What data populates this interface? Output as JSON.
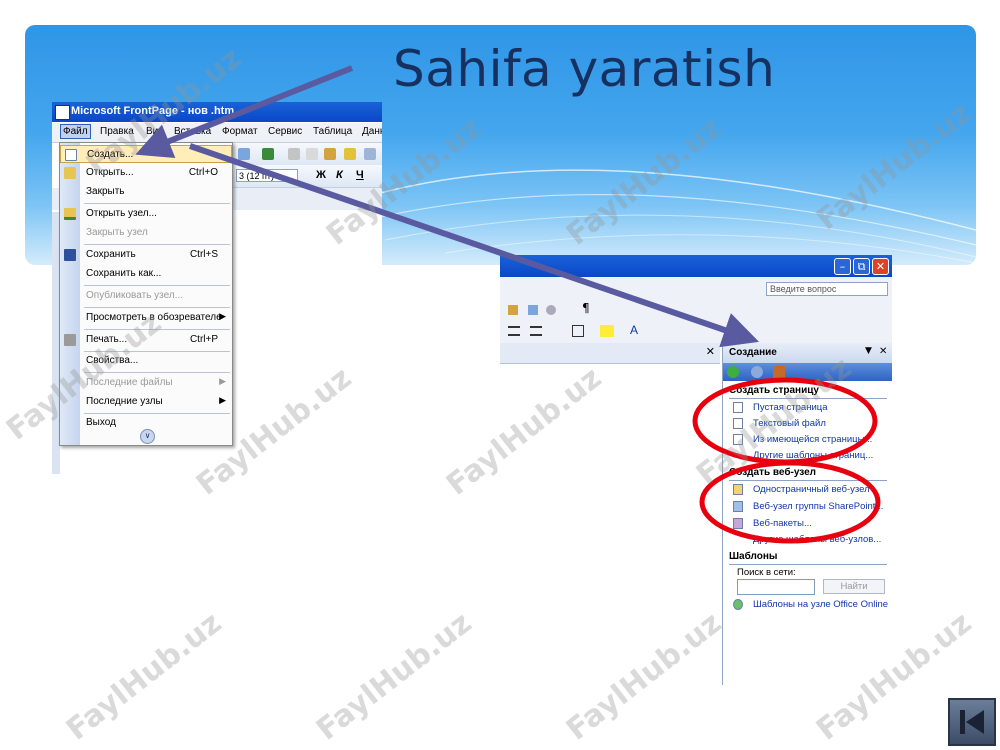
{
  "slide": {
    "title": "Sahifa yaratish"
  },
  "frontpage_window": {
    "title": "Microsoft FrontPage - нов  .htm",
    "menubar": [
      "Файл",
      "Правка",
      "Вид",
      "Вставка",
      "Формат",
      "Сервис",
      "Таблица",
      "Данн"
    ],
    "active_menu": "Файл",
    "file_menu": [
      {
        "label": "Создать...",
        "shortcut": "",
        "submenu": false,
        "disabled": false,
        "highlighted": true,
        "icon": "new-page-icon"
      },
      {
        "label": "Открыть...",
        "shortcut": "Ctrl+O",
        "submenu": false,
        "disabled": false,
        "icon": "open-folder-icon"
      },
      {
        "label": "Закрыть",
        "shortcut": "",
        "submenu": false,
        "disabled": false,
        "icon": ""
      },
      {
        "label": "Открыть узел...",
        "shortcut": "",
        "submenu": false,
        "disabled": false,
        "icon": "open-site-icon"
      },
      {
        "label": "Закрыть узел",
        "shortcut": "",
        "submenu": false,
        "disabled": true,
        "icon": ""
      },
      {
        "label": "Сохранить",
        "shortcut": "Ctrl+S",
        "submenu": false,
        "disabled": false,
        "icon": "save-icon"
      },
      {
        "label": "Сохранить как...",
        "shortcut": "",
        "submenu": false,
        "disabled": false,
        "icon": ""
      },
      {
        "label": "Опубликовать узел...",
        "shortcut": "",
        "submenu": false,
        "disabled": true,
        "icon": ""
      },
      {
        "label": "Просмотреть в обозревателе",
        "shortcut": "",
        "submenu": true,
        "disabled": false,
        "icon": ""
      },
      {
        "label": "Печать...",
        "shortcut": "Ctrl+P",
        "submenu": false,
        "disabled": false,
        "icon": "print-icon"
      },
      {
        "label": "Свойства...",
        "shortcut": "",
        "submenu": false,
        "disabled": false,
        "icon": ""
      },
      {
        "label": "Последние файлы",
        "shortcut": "",
        "submenu": true,
        "disabled": true,
        "icon": ""
      },
      {
        "label": "Последние узлы",
        "shortcut": "",
        "submenu": true,
        "disabled": false,
        "icon": ""
      },
      {
        "label": "Выход",
        "shortcut": "",
        "submenu": false,
        "disabled": false,
        "icon": ""
      }
    ],
    "font_size_value": "3 (12 пт)",
    "bold_label": "Ж",
    "italic_label": "К",
    "underline_label": "Ч"
  },
  "task_window": {
    "ask_question": "Введите вопрос",
    "pane_title": "Создание",
    "sections": [
      {
        "title": "Создать страницу",
        "links": [
          "Пустая страница",
          "Текстовый файл",
          "Из имеющейся страницы...",
          "Другие шаблоны страниц..."
        ]
      },
      {
        "title": "Создать веб-узел",
        "links": [
          "Одностраничный веб-узел",
          "Веб-узел группы SharePoint...",
          "Веб-пакеты...",
          "Другие шаблоны веб-узлов..."
        ]
      },
      {
        "title": "Шаблоны",
        "links": []
      }
    ],
    "search_label": "Поиск в сети:",
    "search_value": "",
    "search_button": "Найти",
    "office_online_link": "Шаблоны на узле Office Online"
  },
  "watermark": "FaylHub.uz",
  "colors": {
    "header_blue": "#2f95e6",
    "title_navy": "#16305f",
    "arrow": "#5a5aa0",
    "highlight_circle": "#e8000f",
    "link_blue": "#1236a6"
  }
}
